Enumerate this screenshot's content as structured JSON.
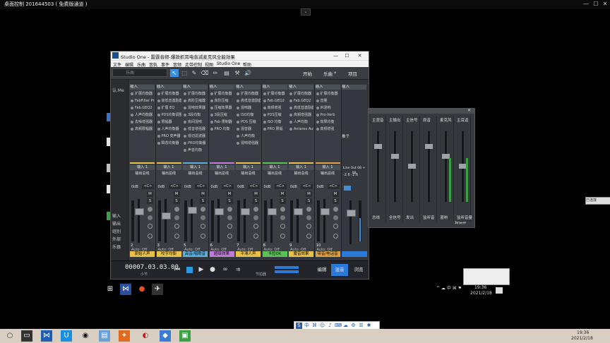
{
  "remote_desktop": {
    "title": "桌面控制 201644503 ( 免费版通道 )",
    "min": "—",
    "max": "☐",
    "close": "✕",
    "toggle": "⌄"
  },
  "studio_one": {
    "title": "Studio One - 雷霆音频-爆款抓耳电音减麦克风全能效果",
    "min": "—",
    "max": "☐",
    "close": "✕",
    "menus": [
      "文件",
      "编辑",
      "乐曲",
      "音轨",
      "事件",
      "音频",
      "走带控制",
      "视图",
      "Studio One",
      "帮助"
    ],
    "song_placeholder": "乐曲",
    "nav": {
      "start": "开始",
      "song": "乐曲",
      "project": "项目"
    },
    "rail": [
      "认.Me",
      "输入",
      "输出",
      "组别",
      "外部",
      "乐器"
    ],
    "transport": {
      "timecode": "00007.03.03.00",
      "unit": "小节",
      "metronome": "节拍器",
      "tabs": [
        "编辑",
        "混音",
        "浏览"
      ]
    },
    "channels": [
      {
        "insert": "插入",
        "plugins": [
          "扩展均衡器",
          "FabFilter Pro-Q3",
          "Fab.GEQ2",
          "人声均衡器",
          "去噪增强器",
          "高频限幅器"
        ],
        "input": "输入 1",
        "output": "输出总线",
        "db": "0dB",
        "pan": "<C>",
        "num": "2",
        "name": "原始人声",
        "color": "#e8c14a"
      },
      {
        "insert": "插入",
        "plugins": [
          "扩展均衡器",
          "高低音激励器",
          "扩展 EQ",
          "PDS均衡调整器",
          "限幅器",
          "人声均衡器",
          "PRO 变声器",
          "瞬态均衡器"
        ],
        "input": "输入 1",
        "output": "输出总线",
        "db": "0dB",
        "pan": "<C>",
        "num": "3",
        "name": "咬字均衡",
        "color": "#e8c14a"
      },
      {
        "insert": "插入",
        "plugins": [
          "扩展均衡器",
          "高阶压缩器",
          "混响效果器",
          "3段均衡",
          "房间混响",
          "低音增强器",
          "低切滤波器",
          "PRO均衡器",
          "声音均衡"
        ],
        "input": "输入 1",
        "output": "输出总线",
        "db": "0dB",
        "pan": "<C>",
        "num": "5",
        "name": "高音/唱歌音",
        "color": "#5bb0e0"
      },
      {
        "insert": "插入",
        "plugins": [
          "扩展均衡器",
          "高阶压缩",
          "压缩效果器",
          "3段压缩",
          "Fab 限制器",
          "PRO 均衡"
        ],
        "input": "输入 1",
        "output": "输出总线",
        "db": "0dB",
        "pan": "<C>",
        "num": "6",
        "name": "超级效果",
        "color": "#c07ad8"
      },
      {
        "insert": "插入",
        "plugins": [
          "扩展均衡器",
          "高低音激励器",
          "混响器",
          "ISO均衡",
          "PDS 压缩",
          "混音器",
          "人声均衡",
          "混响增强器"
        ],
        "input": "输入 1",
        "output": "输出总线",
        "db": "0dB",
        "pan": "<C>",
        "num": "7",
        "name": "平滑人声",
        "color": "#e8c14a"
      },
      {
        "insert": "插入",
        "plugins": [
          "扩展均衡器",
          "Fab.GEQ2",
          "高频增强",
          "PDS压缩",
          "ISO 均衡",
          "PRO 限幅"
        ],
        "input": "输入 1",
        "output": "输出总线",
        "db": "0dB",
        "pan": "<C>",
        "num": "8",
        "name": "卡拉OK",
        "color": "#5ac05a"
      },
      {
        "insert": "插入",
        "plugins": [
          "扩展均衡器",
          "Fab.GEQ2",
          "高低音激励器",
          "高频增强器",
          "人声均衡",
          "Antares Auto-Tune"
        ],
        "input": "输入 1",
        "output": "输出总线",
        "db": "0dB",
        "pan": "<C>",
        "num": "9",
        "name": "魔音效果",
        "color": "#e8c14a"
      },
      {
        "insert": "插入",
        "plugins": [
          "扩展均衡器",
          "音量",
          "IR混响",
          "Pro-Verb",
          "效果均衡",
          "高频增强"
        ],
        "input": "输入 1",
        "output": "输出总线",
        "db": "0dB",
        "pan": "<C>",
        "num": "10",
        "name": "带音/电话音",
        "color": "#e0a040"
      }
    ],
    "master": {
      "insert": "插入",
      "fx_label": "推子",
      "output": "Line Out 08 + 08",
      "db": "-2.6 -2.6",
      "color": "#2c7ad8"
    }
  },
  "mixer2": {
    "labels": [
      "主混音",
      "总线",
      "主输出",
      "全信号",
      "主信号",
      "发出",
      "原音",
      "监听音",
      "麦克风",
      "混响",
      "主耳返",
      "监听音量"
    ],
    "autosave": "自保存"
  },
  "in_taskbar": {
    "time": "19:36",
    "date": "2021/2/18"
  },
  "outer_taskbar": {
    "time": "19:36",
    "date": "2021/2/18"
  },
  "right_chip": "已连接"
}
